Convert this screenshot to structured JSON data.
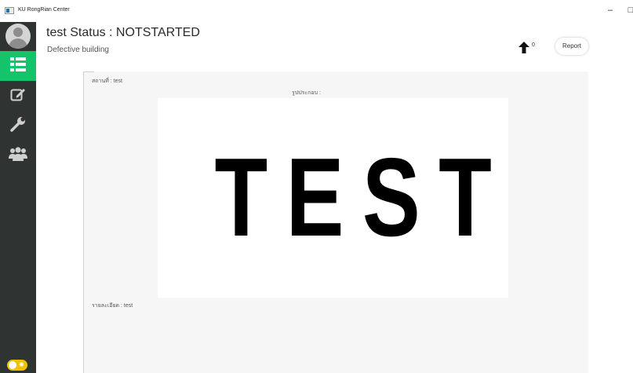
{
  "window": {
    "title": "KU RongRian Center",
    "minimize_glyph": "–",
    "maximize_glyph": "□"
  },
  "sidebar": {
    "items": [
      {
        "name": "avatar",
        "icon": "user-avatar-icon"
      },
      {
        "name": "list",
        "icon": "list-icon",
        "active": true
      },
      {
        "name": "edit",
        "icon": "edit-icon"
      },
      {
        "name": "tools",
        "icon": "wrench-icon"
      },
      {
        "name": "users",
        "icon": "users-icon"
      }
    ],
    "theme_toggle_icon": "sun-icon"
  },
  "header": {
    "title": "test Status : NOTSTARTED",
    "subtitle": "Defective building",
    "upvote_count": "0",
    "report_label": "Report"
  },
  "content": {
    "location_label": "สถานที่ : test",
    "image_label": "รูปประกอบ :",
    "image_text": "TEST",
    "detail_label": "รายละเอียด : test"
  },
  "colors": {
    "sidebar_bg": "#2f3433",
    "active_item": "#15c36b",
    "toggle": "#f2c200",
    "card_bg": "#f6f6f6"
  }
}
